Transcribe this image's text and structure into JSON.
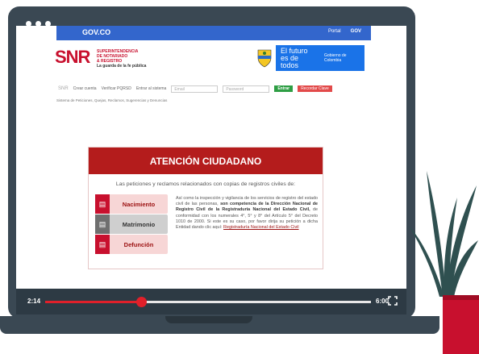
{
  "gov": {
    "logo": "GOV.CO",
    "links": [
      "Portal",
      "GOV"
    ]
  },
  "brand": {
    "acronym": "SNR",
    "line1": "SUPERINTENDENCIA",
    "line2": "DE NOTARIADO",
    "line3": "& REGISTRO",
    "line4": "La guarda de la fe pública"
  },
  "banner": {
    "main": "El futuro es de todos",
    "side": "Gobierno de Colombia"
  },
  "login": {
    "snr": "SNR",
    "create_account": "Crear cuenta",
    "verify": "Verificar PQRSD",
    "enter_label": "Entrar al sistema",
    "email_placeholder": "Email",
    "password_placeholder": "Password",
    "enter_btn": "Entrar",
    "recover_btn": "Recordar Clave"
  },
  "breadcrumb": "Sistema de Peticiones, Quejas, Reclamos, Sugerencias y Denuncias",
  "card": {
    "title": "ATENCIÓN CIUDADANO",
    "subtitle": "Las peticiones y reclamos relacionados con copias de registros civiles de:",
    "categories": [
      "Nacimiento",
      "Matrimonio",
      "Defunción"
    ],
    "desc_a": "Así como la inspección y vigilancia de los servicios de registro del estado civil de las personas, ",
    "desc_b": "son competencia de la Dirección Nacional de Registro Civil de la Registraduría Nacional del Estado Civil,",
    "desc_c": " de conformidad con los numerales 4°, 5° y 8° del Artículo 5° del Decreto 1010 de 2000. Si este es su caso, por favor dirija su petición a dicha Entidad dando clic aquí: ",
    "link": "Registraduría Nacional del Estado Civil"
  },
  "player": {
    "current": "2:14",
    "end": "6:00",
    "progress": 0.295
  },
  "colors": {
    "accent": "#b41c1c",
    "gov_blue": "#3366cc",
    "frame": "#3a4853",
    "progress": "#e0202a"
  },
  "icons": {
    "fullscreen": "fullscreen-icon",
    "document": "document-icon"
  }
}
